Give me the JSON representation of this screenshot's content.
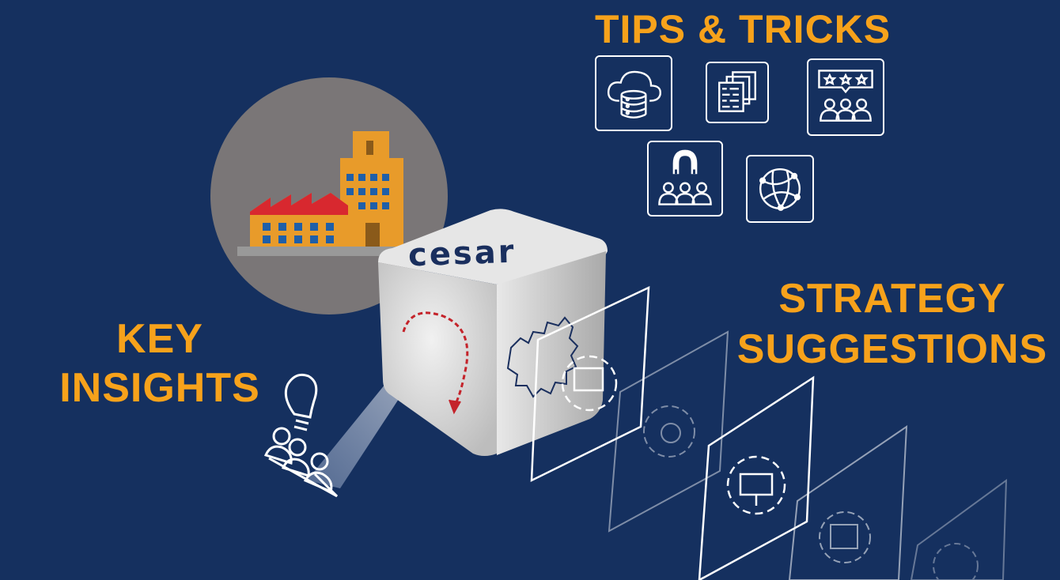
{
  "headings": {
    "tips": "TIPS & TRICKS",
    "strategy_line1": "STRATEGY",
    "strategy_line2": "SUGGESTIONS",
    "key_line1": "KEY",
    "key_line2": "INSIGHTS"
  },
  "cube": {
    "logo": "cesar"
  },
  "icons": {
    "tips": [
      "cloud-database-icon",
      "document-stack-icon",
      "rating-review-icon",
      "magnet-audience-icon",
      "globe-network-icon"
    ],
    "strategy_panels": [
      "gear-icon",
      "gear-monitor-icon",
      "gear-euro-coins-icon",
      "gear-presentation-icon",
      "gear-calendar-icon",
      "gear-chart-icon"
    ],
    "insights": [
      "lightbulb-icon",
      "people-group-icon"
    ]
  },
  "colors": {
    "background": "#15305f",
    "accent": "#f7a21b",
    "circle": "#7a7677",
    "cube": "#d9d9d9",
    "logo": "#1a2f5e"
  }
}
